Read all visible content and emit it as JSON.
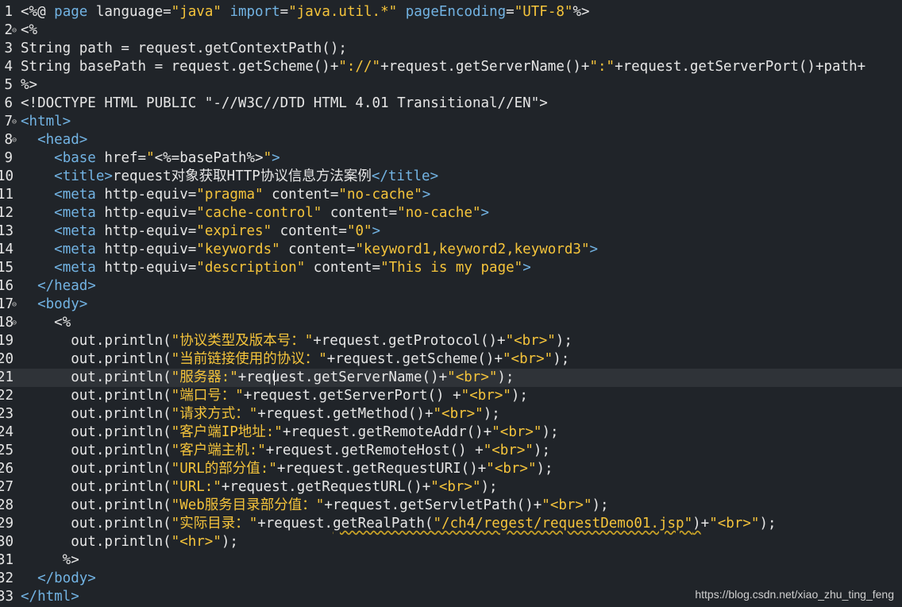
{
  "colors": {
    "background": "#202429",
    "current_line": "#2f3338",
    "tag": "#72b3e3",
    "string": "#f5c43b",
    "plain": "#e6e6e6"
  },
  "editor": {
    "current_line_number": "21",
    "lines": [
      {
        "n": "1",
        "fold": false,
        "tokens": [
          [
            "plain",
            "<%@ "
          ],
          [
            "kw",
            "page"
          ],
          [
            "plain",
            " language="
          ],
          [
            "str",
            "\"java\""
          ],
          [
            "plain",
            " "
          ],
          [
            "kw",
            "import"
          ],
          [
            "plain",
            "="
          ],
          [
            "str",
            "\"java.util.*\""
          ],
          [
            "plain",
            " "
          ],
          [
            "kw",
            "pageEncoding"
          ],
          [
            "plain",
            "="
          ],
          [
            "str",
            "\"UTF-8\""
          ],
          [
            "plain",
            "%>"
          ]
        ]
      },
      {
        "n": "2",
        "fold": true,
        "tokens": [
          [
            "plain",
            "<%"
          ]
        ]
      },
      {
        "n": "3",
        "fold": false,
        "tokens": [
          [
            "plain",
            "String path = request.getContextPath();"
          ]
        ]
      },
      {
        "n": "4",
        "fold": false,
        "tokens": [
          [
            "plain",
            "String basePath = request.getScheme()+"
          ],
          [
            "str",
            "\"://\""
          ],
          [
            "plain",
            "+request.getServerName()+"
          ],
          [
            "str",
            "\":\""
          ],
          [
            "plain",
            "+request.getServerPort()+path+"
          ]
        ]
      },
      {
        "n": "5",
        "fold": false,
        "tokens": [
          [
            "plain",
            "%>"
          ]
        ]
      },
      {
        "n": "6",
        "fold": false,
        "tokens": [
          [
            "plain",
            "<!DOCTYPE HTML PUBLIC \"-//W3C//DTD HTML 4.01 Transitional//EN\">"
          ]
        ]
      },
      {
        "n": "7",
        "fold": true,
        "tokens": [
          [
            "tag",
            "<html>"
          ]
        ]
      },
      {
        "n": "8",
        "fold": true,
        "tokens": [
          [
            "plain",
            "  "
          ],
          [
            "tag",
            "<head>"
          ]
        ]
      },
      {
        "n": "9",
        "fold": false,
        "tokens": [
          [
            "plain",
            "    "
          ],
          [
            "tag",
            "<base"
          ],
          [
            "plain",
            " href="
          ],
          [
            "str",
            "\""
          ],
          [
            "plain",
            "<%=basePath%>"
          ],
          [
            "str",
            "\""
          ],
          [
            "tag",
            ">"
          ]
        ]
      },
      {
        "n": "10",
        "fold": false,
        "tokens": [
          [
            "plain",
            "    "
          ],
          [
            "tag",
            "<title>"
          ],
          [
            "plain",
            "request对象获取HTTP协议信息方法案例"
          ],
          [
            "tag",
            "</title>"
          ]
        ]
      },
      {
        "n": "11",
        "fold": false,
        "tokens": [
          [
            "plain",
            "    "
          ],
          [
            "tag",
            "<meta"
          ],
          [
            "plain",
            " http-equiv="
          ],
          [
            "str",
            "\"pragma\""
          ],
          [
            "plain",
            " content="
          ],
          [
            "str",
            "\"no-cache\""
          ],
          [
            "tag",
            ">"
          ]
        ]
      },
      {
        "n": "12",
        "fold": false,
        "tokens": [
          [
            "plain",
            "    "
          ],
          [
            "tag",
            "<meta"
          ],
          [
            "plain",
            " http-equiv="
          ],
          [
            "str",
            "\"cache-control\""
          ],
          [
            "plain",
            " content="
          ],
          [
            "str",
            "\"no-cache\""
          ],
          [
            "tag",
            ">"
          ]
        ]
      },
      {
        "n": "13",
        "fold": false,
        "tokens": [
          [
            "plain",
            "    "
          ],
          [
            "tag",
            "<meta"
          ],
          [
            "plain",
            " http-equiv="
          ],
          [
            "str",
            "\"expires\""
          ],
          [
            "plain",
            " content="
          ],
          [
            "str",
            "\"0\""
          ],
          [
            "tag",
            ">"
          ]
        ]
      },
      {
        "n": "14",
        "fold": false,
        "tokens": [
          [
            "plain",
            "    "
          ],
          [
            "tag",
            "<meta"
          ],
          [
            "plain",
            " http-equiv="
          ],
          [
            "str",
            "\"keywords\""
          ],
          [
            "plain",
            " content="
          ],
          [
            "str",
            "\"keyword1,keyword2,keyword3\""
          ],
          [
            "tag",
            ">"
          ]
        ]
      },
      {
        "n": "15",
        "fold": false,
        "tokens": [
          [
            "plain",
            "    "
          ],
          [
            "tag",
            "<meta"
          ],
          [
            "plain",
            " http-equiv="
          ],
          [
            "str",
            "\"description\""
          ],
          [
            "plain",
            " content="
          ],
          [
            "str",
            "\"This is my page\""
          ],
          [
            "tag",
            ">"
          ]
        ]
      },
      {
        "n": "16",
        "fold": false,
        "tokens": [
          [
            "plain",
            "  "
          ],
          [
            "tag",
            "</head>"
          ]
        ]
      },
      {
        "n": "17",
        "fold": true,
        "tokens": [
          [
            "plain",
            "  "
          ],
          [
            "tag",
            "<body>"
          ]
        ]
      },
      {
        "n": "18",
        "fold": true,
        "tokens": [
          [
            "plain",
            "    <%"
          ]
        ]
      },
      {
        "n": "19",
        "fold": false,
        "tokens": [
          [
            "plain",
            "      out.println("
          ],
          [
            "str",
            "\"协议类型及版本号：\""
          ],
          [
            "plain",
            "+request.getProtocol()+"
          ],
          [
            "str",
            "\"<br>\""
          ],
          [
            "plain",
            ");"
          ]
        ]
      },
      {
        "n": "20",
        "fold": false,
        "tokens": [
          [
            "plain",
            "      out.println("
          ],
          [
            "str",
            "\"当前链接使用的协议：\""
          ],
          [
            "plain",
            "+request.getScheme()+"
          ],
          [
            "str",
            "\"<br>\""
          ],
          [
            "plain",
            ");"
          ]
        ]
      },
      {
        "n": "21",
        "fold": false,
        "tokens": [
          [
            "plain",
            "      out.println("
          ],
          [
            "str",
            "\"服务器:\""
          ],
          [
            "plain",
            "+request.getServerName()+"
          ],
          [
            "str",
            "\"<br>\""
          ],
          [
            "plain",
            ");"
          ]
        ]
      },
      {
        "n": "22",
        "fold": false,
        "tokens": [
          [
            "plain",
            "      out.println("
          ],
          [
            "str",
            "\"端口号：\""
          ],
          [
            "plain",
            "+request.getServerPort() +"
          ],
          [
            "str",
            "\"<br>\""
          ],
          [
            "plain",
            ");"
          ]
        ]
      },
      {
        "n": "23",
        "fold": false,
        "tokens": [
          [
            "plain",
            "      out.println("
          ],
          [
            "str",
            "\"请求方式：\""
          ],
          [
            "plain",
            "+request.getMethod()+"
          ],
          [
            "str",
            "\"<br>\""
          ],
          [
            "plain",
            ");"
          ]
        ]
      },
      {
        "n": "24",
        "fold": false,
        "tokens": [
          [
            "plain",
            "      out.println("
          ],
          [
            "str",
            "\"客户端IP地址:\""
          ],
          [
            "plain",
            "+request.getRemoteAddr()+"
          ],
          [
            "str",
            "\"<br>\""
          ],
          [
            "plain",
            ");"
          ]
        ]
      },
      {
        "n": "25",
        "fold": false,
        "tokens": [
          [
            "plain",
            "      out.println("
          ],
          [
            "str",
            "\"客户端主机:\""
          ],
          [
            "plain",
            "+request.getRemoteHost() +"
          ],
          [
            "str",
            "\"<br>\""
          ],
          [
            "plain",
            ");"
          ]
        ]
      },
      {
        "n": "26",
        "fold": false,
        "tokens": [
          [
            "plain",
            "      out.println("
          ],
          [
            "str",
            "\"URL的部分值:\""
          ],
          [
            "plain",
            "+request.getRequestURI()+"
          ],
          [
            "str",
            "\"<br>\""
          ],
          [
            "plain",
            ");"
          ]
        ]
      },
      {
        "n": "27",
        "fold": false,
        "tokens": [
          [
            "plain",
            "      out.println("
          ],
          [
            "str",
            "\"URL:\""
          ],
          [
            "plain",
            "+request.getRequestURL()+"
          ],
          [
            "str",
            "\"<br>\""
          ],
          [
            "plain",
            ");"
          ]
        ]
      },
      {
        "n": "28",
        "fold": false,
        "tokens": [
          [
            "plain",
            "      out.println("
          ],
          [
            "str",
            "\"Web服务目录部分值：\""
          ],
          [
            "plain",
            "+request.getServletPath()+"
          ],
          [
            "str",
            "\"<br>\""
          ],
          [
            "plain",
            ");"
          ]
        ]
      },
      {
        "n": "29",
        "fold": false,
        "tokens": [
          [
            "plain",
            "      out.println("
          ],
          [
            "str",
            "\"实际目录：\""
          ],
          [
            "plain",
            "+request."
          ],
          [
            "sq",
            "getRealPath("
          ],
          [
            "sqstr",
            "\"/ch4/regest/requestDemo01.jsp\""
          ],
          [
            "sq",
            ")"
          ],
          [
            "plain",
            "+"
          ],
          [
            "str",
            "\"<br>\""
          ],
          [
            "plain",
            ");"
          ]
        ]
      },
      {
        "n": "30",
        "fold": false,
        "tokens": [
          [
            "plain",
            "      out.println("
          ],
          [
            "str",
            "\"<hr>\""
          ],
          [
            "plain",
            ");"
          ]
        ]
      },
      {
        "n": "31",
        "fold": false,
        "tokens": [
          [
            "plain",
            "     %>"
          ]
        ]
      },
      {
        "n": "32",
        "fold": false,
        "tokens": [
          [
            "plain",
            "  "
          ],
          [
            "tag",
            "</body>"
          ]
        ]
      },
      {
        "n": "33",
        "fold": false,
        "tokens": [
          [
            "tag",
            "</html>"
          ]
        ]
      }
    ]
  },
  "watermark": "https://blog.csdn.net/xiao_zhu_ting_feng"
}
